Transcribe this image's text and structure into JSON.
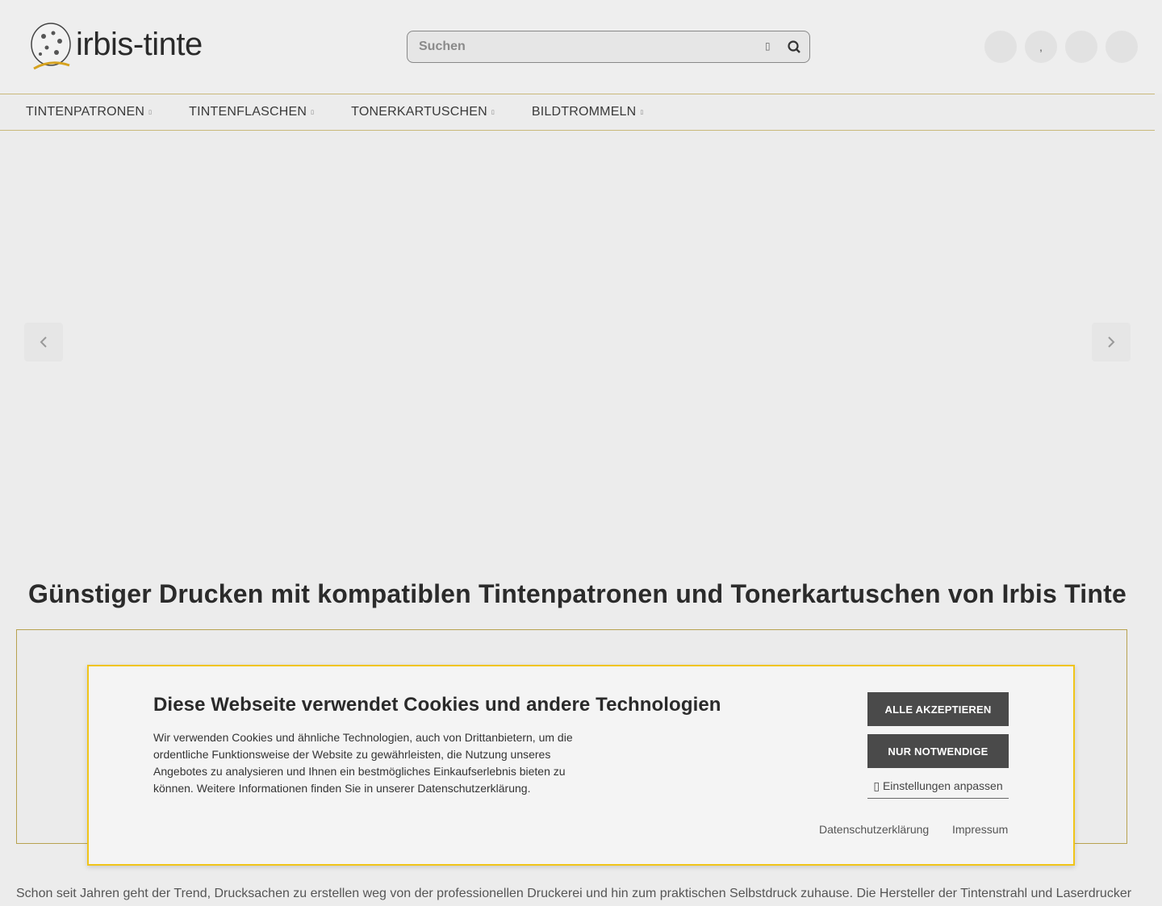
{
  "header": {
    "logo_text": "irbis-tinte",
    "search_placeholder": "Suchen",
    "icons": [
      "user-icon",
      "wishlist-icon",
      "compare-icon",
      "cart-icon"
    ],
    "icon_glyphs": [
      "",
      ",",
      "",
      ""
    ]
  },
  "nav": {
    "items": [
      {
        "label": "TINTENPATRONEN"
      },
      {
        "label": "TINTENFLASCHEN"
      },
      {
        "label": "TONERKARTUSCHEN"
      },
      {
        "label": "BILDTROMMELN"
      }
    ]
  },
  "main": {
    "title": "Günstiger Drucken mit kompatiblen Tintenpatronen und Tonerkartuschen von Irbis Tinte",
    "bottom_text": "Schon seit Jahren geht der Trend, Drucksachen zu erstellen weg von der professionellen Druckerei und hin zum praktischen Selbstdruck zuhause. Die Hersteller der Tintenstrahl und Laserdrucker"
  },
  "cookie": {
    "title": "Diese Webseite verwendet Cookies und andere Technologien",
    "text": "Wir verwenden Cookies und ähnliche Technologien, auch von Drittanbietern, um die ordentliche Funktionsweise der Website zu gewährleisten, die Nutzung unseres Angebotes zu analysieren und Ihnen ein bestmögliches Einkaufserlebnis bieten zu können. Weitere Informationen finden Sie in unserer Datenschutzerklärung.",
    "accept_all": "ALLE AKZEPTIEREN",
    "only_necessary": "NUR NOTWENDIGE",
    "settings": "Einstellungen anpassen",
    "privacy": "Datenschutzerklärung",
    "imprint": "Impressum"
  },
  "colors": {
    "accent": "#f0c419",
    "border_gold": "#b8a250",
    "button_dark": "#4a4a4a"
  }
}
